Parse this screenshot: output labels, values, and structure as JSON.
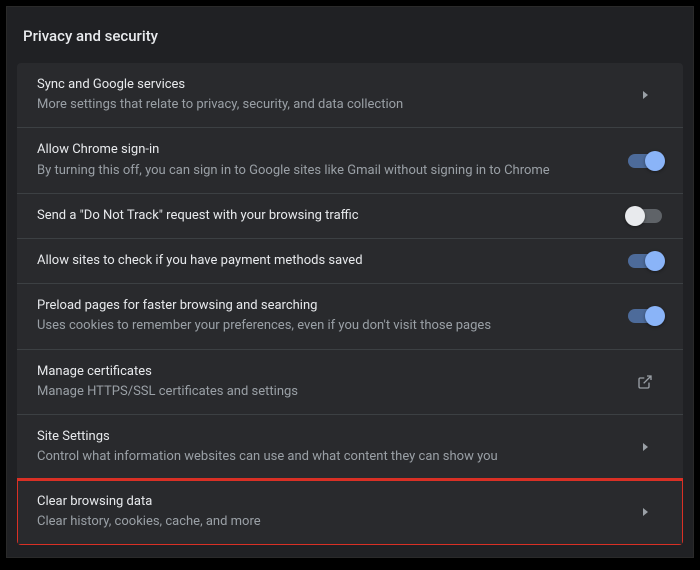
{
  "section_title": "Privacy and security",
  "rows": {
    "sync": {
      "title": "Sync and Google services",
      "sub": "More settings that relate to privacy, security, and data collection"
    },
    "signin": {
      "title": "Allow Chrome sign-in",
      "sub": "By turning this off, you can sign in to Google sites like Gmail without signing in to Chrome",
      "toggle": true
    },
    "dnt": {
      "title": "Send a \"Do Not Track\" request with your browsing traffic",
      "toggle": false
    },
    "payment": {
      "title": "Allow sites to check if you have payment methods saved",
      "toggle": true
    },
    "preload": {
      "title": "Preload pages for faster browsing and searching",
      "sub": "Uses cookies to remember your preferences, even if you don't visit those pages",
      "toggle": true
    },
    "certs": {
      "title": "Manage certificates",
      "sub": "Manage HTTPS/SSL certificates and settings"
    },
    "site": {
      "title": "Site Settings",
      "sub": "Control what information websites can use and what content they can show you"
    },
    "clear": {
      "title": "Clear browsing data",
      "sub": "Clear history, cookies, cache, and more"
    }
  }
}
